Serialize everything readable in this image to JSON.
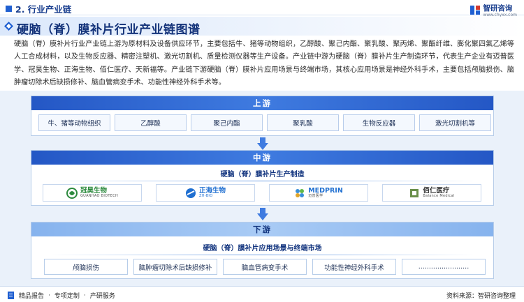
{
  "header": {
    "section": "2. 行业产业链",
    "brand_cn": "智研咨询",
    "brand_en": "www.chyxx.com"
  },
  "title": "硬脑（脊）膜补片行业产业链图谱",
  "intro": "硬脑（脊）膜补片行业产业链上游为原材料及设备供应环节，主要包括牛、猪等动物组织，乙醇酸、聚己内酯、聚乳酸、聚丙烯、聚酯纤维、膨化聚四氟乙烯等人工合成材料，以及生物反应器、精密注塑机、激光切割机、质量检测仪器等生产设备。产业链中游为硬脑（脊）膜补片生产制造环节，代表生产企业有迈普医学、冠昊生物、正海生物、佰仁医疗、天新福等。产业链下游硬脑（脊）膜补片应用场景与终端市场，其核心应用场景是神经外科手术，主要包括颅脑损伤、脑肿瘤切除术后缺损修补、脑血管病变手术、功能性神经外科手术等。",
  "upstream": {
    "label": "上游",
    "items": [
      "牛、猪等动物组织",
      "乙醇酸",
      "聚己内酯",
      "聚乳酸",
      "生物反应器",
      "激光切割机等"
    ]
  },
  "midstream": {
    "label": "中游",
    "subtitle": "硬脑（脊）膜补片生产制造",
    "companies": [
      {
        "cn": "冠昊生物",
        "en": "GUANHAO BIOTECH",
        "icon": "guanhao-logo-icon"
      },
      {
        "cn": "正海生物",
        "en": "ZH-BIO",
        "icon": "zhbio-logo-icon"
      },
      {
        "cn": "MEDPRIN",
        "en": "迈普医学",
        "icon": "medprin-logo-icon"
      },
      {
        "cn": "佰仁医疗",
        "en": "Balance Medical",
        "icon": "balance-logo-icon"
      }
    ]
  },
  "downstream": {
    "label": "下游",
    "subtitle": "硬脑（脊）膜补片应用场景与终端市场",
    "items": [
      "颅脑损伤",
      "脑肿瘤切除术后缺损修补",
      "脑血管病变手术",
      "功能性神经外科手术",
      "........................"
    ]
  },
  "footer": {
    "items": [
      "精品报告",
      "专项定制",
      "产研服务"
    ],
    "source": "资料来源：智研咨询整理"
  },
  "colors": {
    "primary": "#2457c5",
    "light": "#a9cbf5",
    "background": "#eaf1fa"
  }
}
